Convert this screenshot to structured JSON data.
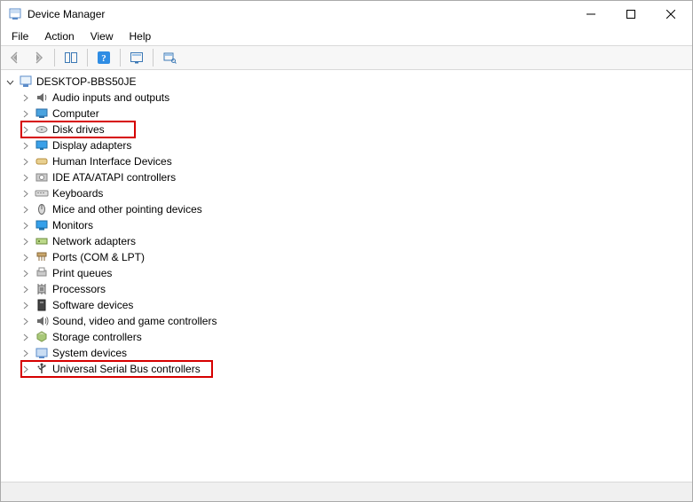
{
  "window": {
    "title": "Device Manager"
  },
  "menu": {
    "file": "File",
    "action": "Action",
    "view": "View",
    "help": "Help"
  },
  "tree": {
    "root": "DESKTOP-BBS50JE",
    "items": {
      "audio": "Audio inputs and outputs",
      "computer": "Computer",
      "disk": "Disk drives",
      "display": "Display adapters",
      "hid": "Human Interface Devices",
      "ide": "IDE ATA/ATAPI controllers",
      "keyboards": "Keyboards",
      "mice": "Mice and other pointing devices",
      "monitors": "Monitors",
      "network": "Network adapters",
      "ports": "Ports (COM & LPT)",
      "printq": "Print queues",
      "processors": "Processors",
      "software": "Software devices",
      "soundvideo": "Sound, video and game controllers",
      "storage": "Storage controllers",
      "system": "System devices",
      "usb": "Universal Serial Bus controllers"
    }
  }
}
